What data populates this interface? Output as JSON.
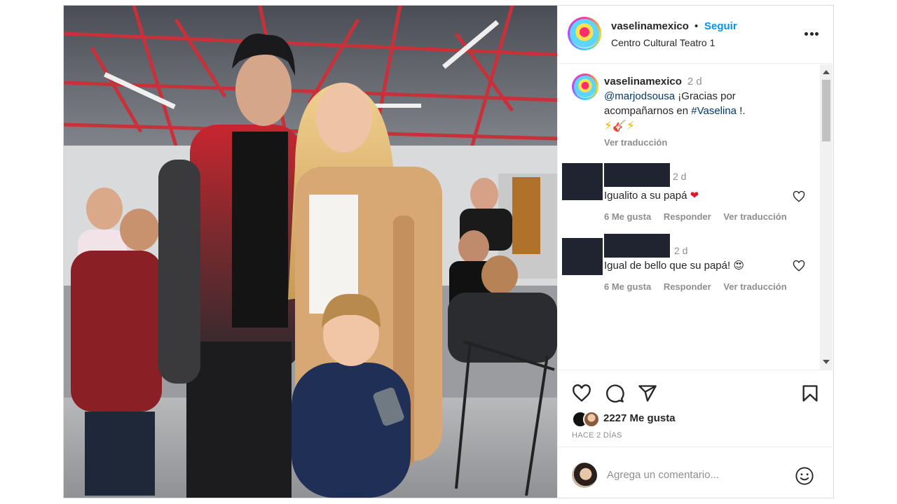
{
  "post": {
    "photo_icon": "concert-photo",
    "header": {
      "username": "vaselinamexico",
      "separator": "•",
      "follow_label": "Seguir",
      "location": "Centro Cultural Teatro 1",
      "more_icon": "more-horizontal-icon"
    },
    "caption": {
      "username": "vaselinamexico",
      "time": "2 d",
      "mention": "@marjodsousa",
      "text_1": " ¡Gracias por acompañarnos en ",
      "hashtag": "#Vaselina",
      "text_2": " !.",
      "emoji_1": "⚡",
      "emoji_2": "🎸",
      "emoji_3": "⚡",
      "see_translation": "Ver traducción"
    },
    "comments": [
      {
        "time": "2 d",
        "text": "Igualito a su papá",
        "emoji": "❤",
        "likes": "6 Me gusta",
        "reply": "Responder",
        "translate": "Ver traducción"
      },
      {
        "time": "2 d",
        "text": "Igual de bello que su papá!",
        "emoji": "😍",
        "likes": "6 Me gusta",
        "reply": "Responder",
        "translate": "Ver traducción"
      }
    ],
    "actions": {
      "likes_label": "2227 Me gusta",
      "ago": "HACE 2 DÍAS"
    },
    "add_comment": {
      "placeholder": "Agrega un comentario..."
    },
    "colors": {
      "link": "#0095f6",
      "mention": "#00376b",
      "muted": "#8e8e8e",
      "text": "#262626"
    }
  }
}
